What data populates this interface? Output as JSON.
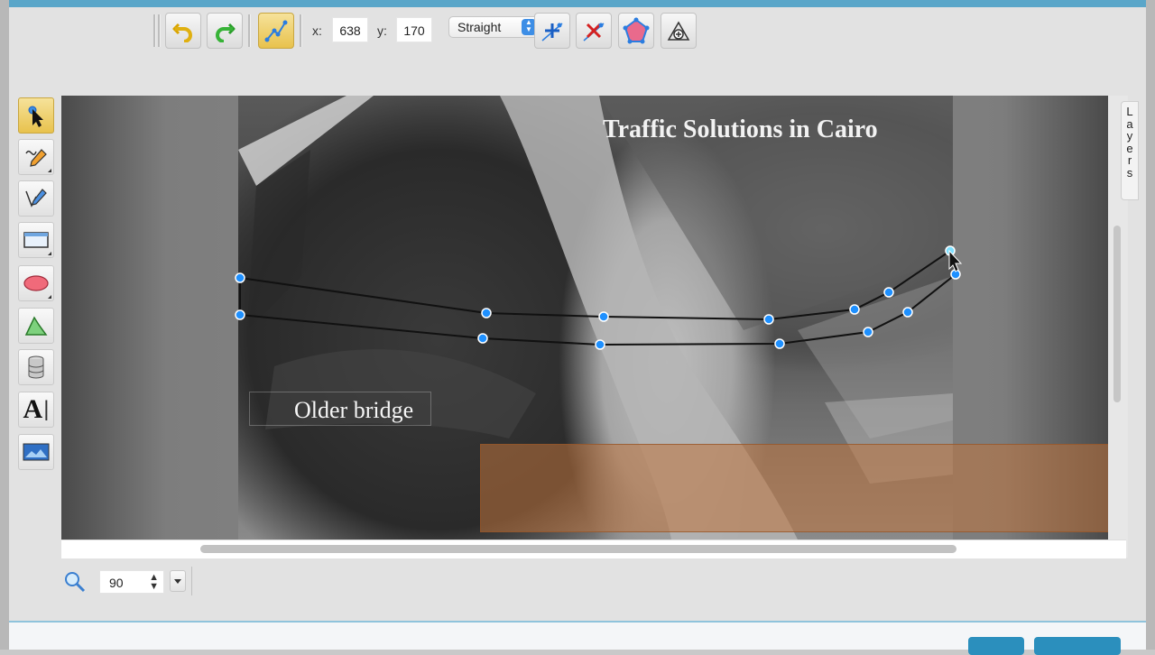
{
  "toolbar": {
    "undo_icon": "undo-icon",
    "redo_icon": "redo-icon",
    "node_edit_icon": "node-edit-icon",
    "x_label": "x:",
    "x_value": "638",
    "y_label": "y:",
    "y_value": "170",
    "segment_type": "Straight",
    "add_node_icon": "add-node-icon",
    "delete_node_icon": "delete-node-icon",
    "open_close_path_icon": "open-close-path-icon",
    "clone_node_icon": "clone-node-icon"
  },
  "tools": [
    "select-tool-icon",
    "pencil-tool-icon",
    "pen-tool-icon",
    "rectangle-tool-icon",
    "ellipse-tool-icon",
    "path-tool-icon",
    "shapelib-tool-icon",
    "text-tool-icon",
    "image-tool-icon"
  ],
  "text_tool_glyph": "A",
  "canvas": {
    "title": "Traffic Solutions in Cairo",
    "caption": "Older bridge"
  },
  "layers_tab": [
    "L",
    "a",
    "y",
    "e",
    "r",
    "s"
  ],
  "zoom": {
    "value": "90"
  },
  "colors": {
    "accent": "#5aa6c9",
    "active_tool": "#e8c24d",
    "node": "#1e90ff",
    "highlight_box": "#be733c"
  }
}
